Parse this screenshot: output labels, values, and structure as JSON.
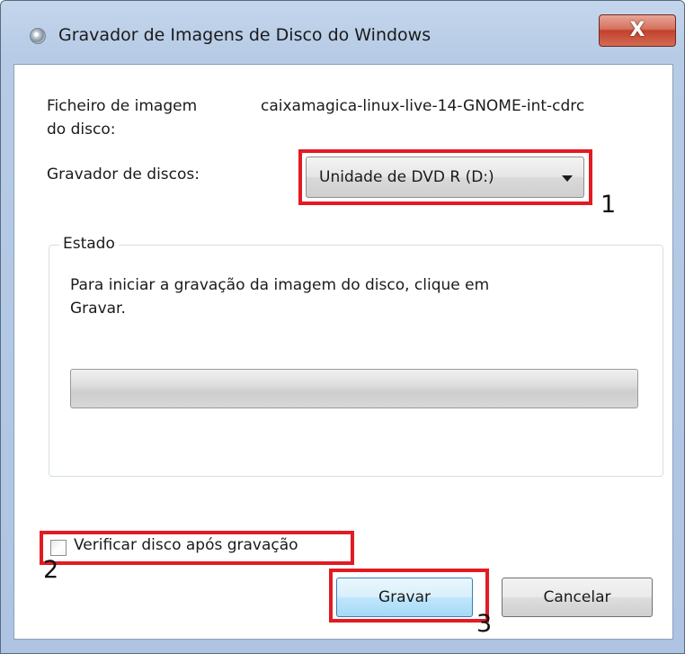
{
  "window": {
    "title": "Gravador de Imagens de Disco do Windows",
    "close_label": "X"
  },
  "form": {
    "file_label_line1": "Ficheiro de imagem",
    "file_label_line2": "do disco:",
    "file_value": "caixamagica-linux-live-14-GNOME-int-cdrc",
    "burner_label": "Gravador de discos:",
    "burner_selected": "Unidade de DVD R (D:)"
  },
  "status": {
    "group_title": "Estado",
    "message_line1": "Para iniciar a gravação da imagem do disco, clique em",
    "message_line2": "Gravar.",
    "progress": 0
  },
  "verify": {
    "label": "Verificar disco após gravação",
    "checked": false
  },
  "buttons": {
    "burn": "Gravar",
    "cancel": "Cancelar"
  },
  "annotations": {
    "step1": "1",
    "step2": "2",
    "step3": "3",
    "highlight_color": "#e21b23"
  },
  "icons": {
    "title_icon": "disc-icon",
    "dropdown_arrow": "chevron-down-icon",
    "close": "close-icon"
  }
}
